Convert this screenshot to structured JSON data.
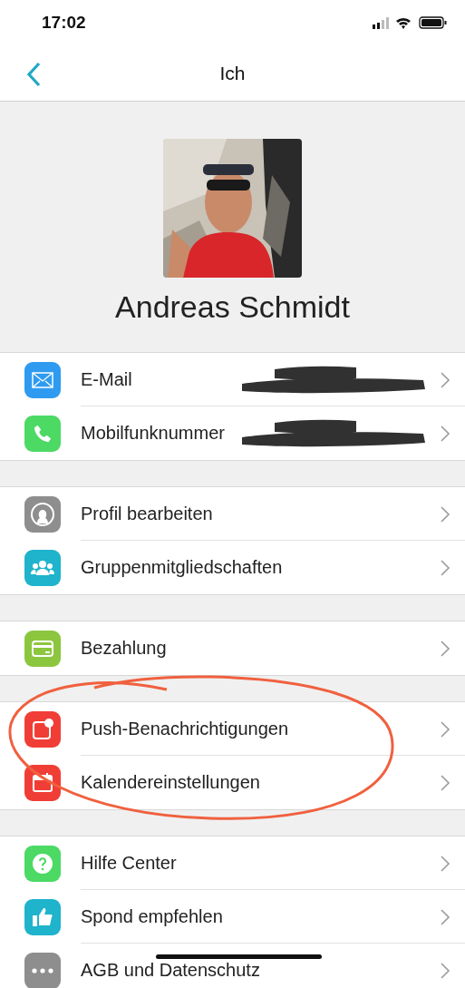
{
  "status_bar": {
    "time": "17:02"
  },
  "nav": {
    "title": "Ich"
  },
  "profile": {
    "name": "Andreas Schmidt"
  },
  "groups": [
    {
      "items": [
        {
          "label": "E-Mail",
          "kind": "mail",
          "color": "#2e9bf0",
          "redacted": true
        },
        {
          "label": "Mobilfunknummer",
          "kind": "phone",
          "color": "#4cd964",
          "redacted": true
        }
      ]
    },
    {
      "items": [
        {
          "label": "Profil bearbeiten",
          "kind": "profile",
          "color": "#8e8e8e",
          "redacted": false
        },
        {
          "label": "Gruppenmitgliedschaften",
          "kind": "group",
          "color": "#1fb3cc",
          "redacted": false
        }
      ]
    },
    {
      "items": [
        {
          "label": "Bezahlung",
          "kind": "card",
          "color": "#8cc63f",
          "redacted": false
        }
      ]
    },
    {
      "items": [
        {
          "label": "Push-Benachrichtigungen",
          "kind": "push",
          "color": "#f03e36",
          "redacted": false
        },
        {
          "label": "Kalendereinstellungen",
          "kind": "calendar",
          "color": "#f03e36",
          "redacted": false
        }
      ]
    },
    {
      "items": [
        {
          "label": "Hilfe Center",
          "kind": "help",
          "color": "#4cd964",
          "redacted": false
        },
        {
          "label": "Spond empfehlen",
          "kind": "thumb",
          "color": "#1fb3cc",
          "redacted": false
        },
        {
          "label": "AGB und Datenschutz",
          "kind": "more",
          "color": "#8e8e8e",
          "redacted": false
        }
      ]
    }
  ],
  "annotation": {
    "kind": "circle",
    "color": "#f0603e"
  }
}
